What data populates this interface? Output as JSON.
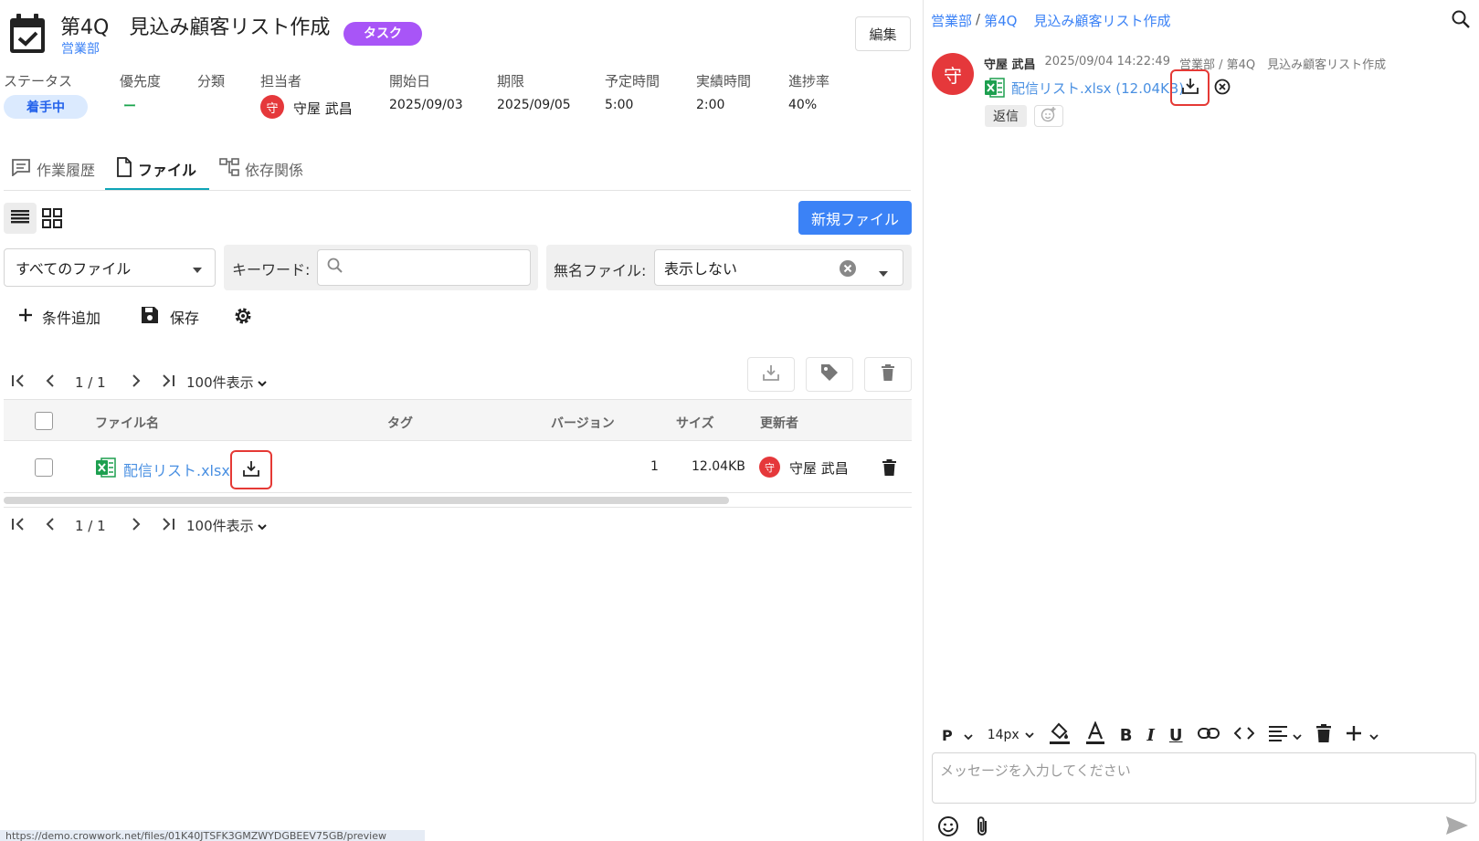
{
  "task": {
    "title": "第4Q　見込み顧客リスト作成",
    "department": "営業部",
    "type_badge": "タスク",
    "edit_label": "編集"
  },
  "meta": {
    "labels": [
      "ステータス",
      "優先度",
      "分類",
      "担当者",
      "開始日",
      "期限",
      "予定時間",
      "実績時間",
      "進捗率"
    ],
    "status": "着手中",
    "priority": "ー",
    "assignee_initial": "守",
    "assignee": "守屋 武昌",
    "start_date": "2025/09/03",
    "due_date": "2025/09/05",
    "planned_time": "5:00",
    "actual_time": "2:00",
    "progress": "40%"
  },
  "tabs": [
    {
      "label": "作業履歴",
      "active": false
    },
    {
      "label": "ファイル",
      "active": true
    },
    {
      "label": "依存関係",
      "active": false
    }
  ],
  "toolbar": {
    "new_file_label": "新規ファイル",
    "file_filter_value": "すべてのファイル",
    "keyword_label": "キーワード:",
    "keyword_placeholder": "",
    "unnamed_label": "無名ファイル:",
    "unnamed_value": "表示しない",
    "add_condition_label": "条件追加",
    "save_label": "保存"
  },
  "pager": {
    "page": "1 / 1",
    "per_page": "100件表示"
  },
  "table": {
    "columns": [
      "ファイル名",
      "タグ",
      "バージョン",
      "サイズ",
      "更新者"
    ],
    "rows": [
      {
        "file_name": "配信リスト.xlsx",
        "tag": "",
        "version": "1",
        "size": "12.04KB",
        "updater_initial": "守",
        "updater": "守屋 武昌"
      }
    ]
  },
  "status_bar": "https://demo.crowwork.net/files/01K40JTSFK3GMZWYDGBEEV75GB/preview",
  "chat": {
    "breadcrumb": [
      "営業部",
      "第4Q",
      "見込み顧客リスト作成"
    ],
    "message": {
      "avatar_initial": "守",
      "author": "守屋 武昌",
      "timestamp": "2025/09/04 14:22:49",
      "context": "営業部 / 第4Q　見込み顧客リスト作成",
      "attachment": "配信リスト.xlsx (12.04KB)",
      "reply_label": "返信"
    },
    "editor": {
      "paragraph": "P",
      "font_size": "14px",
      "placeholder": "メッセージを入力してください"
    }
  },
  "colors": {
    "primary": "#3b82f6",
    "badge_task": "#a855f7",
    "avatar": "#e5383b",
    "highlight": "#e53935",
    "excel": "#1d9f4f"
  }
}
